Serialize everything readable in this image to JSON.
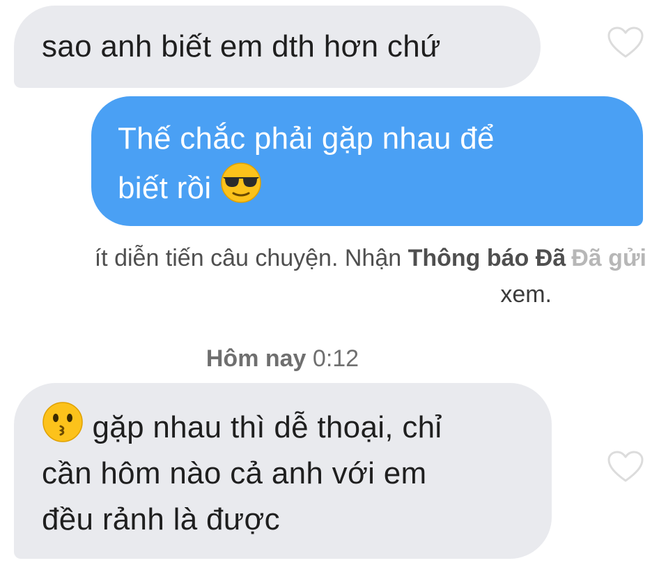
{
  "messages": [
    {
      "direction": "received",
      "lines": [
        "sao anh biết em dth hơn chứ"
      ],
      "liked": false
    },
    {
      "direction": "sent",
      "lines": [
        "Thế chắc phải gặp nhau để",
        "biết rồi"
      ],
      "trailing_emoji": "smiling-face-with-sunglasses"
    },
    {
      "direction": "received",
      "leading_emoji": "kissing-face",
      "lines": [
        "gặp nhau thì dễ thoại, chỉ",
        "cần hôm nào cả anh với em",
        "đều rảnh là được"
      ],
      "liked": false
    }
  ],
  "read_receipt": {
    "text": "ít diễn tiến câu chuyện. Nhận",
    "bold": "Thông báo Đã",
    "trailing": "xem.",
    "sent_label": "Đã gửi"
  },
  "timestamp": {
    "day": "Hôm nay",
    "time": "0:12"
  },
  "colors": {
    "sent_bubble": "#4aa0f4",
    "received_bubble": "#e9eaee"
  }
}
